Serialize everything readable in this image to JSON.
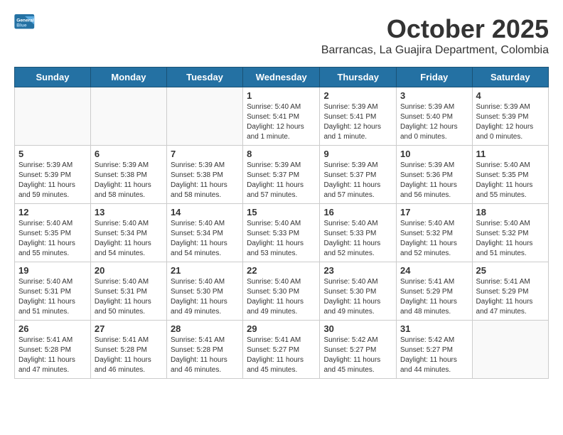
{
  "logo": {
    "line1": "General",
    "line2": "Blue"
  },
  "header": {
    "month_year": "October 2025",
    "location": "Barrancas, La Guajira Department, Colombia"
  },
  "days_of_week": [
    "Sunday",
    "Monday",
    "Tuesday",
    "Wednesday",
    "Thursday",
    "Friday",
    "Saturday"
  ],
  "weeks": [
    [
      {
        "day": "",
        "info": ""
      },
      {
        "day": "",
        "info": ""
      },
      {
        "day": "",
        "info": ""
      },
      {
        "day": "1",
        "info": "Sunrise: 5:40 AM\nSunset: 5:41 PM\nDaylight: 12 hours\nand 1 minute."
      },
      {
        "day": "2",
        "info": "Sunrise: 5:39 AM\nSunset: 5:41 PM\nDaylight: 12 hours\nand 1 minute."
      },
      {
        "day": "3",
        "info": "Sunrise: 5:39 AM\nSunset: 5:40 PM\nDaylight: 12 hours\nand 0 minutes."
      },
      {
        "day": "4",
        "info": "Sunrise: 5:39 AM\nSunset: 5:39 PM\nDaylight: 12 hours\nand 0 minutes."
      }
    ],
    [
      {
        "day": "5",
        "info": "Sunrise: 5:39 AM\nSunset: 5:39 PM\nDaylight: 11 hours\nand 59 minutes."
      },
      {
        "day": "6",
        "info": "Sunrise: 5:39 AM\nSunset: 5:38 PM\nDaylight: 11 hours\nand 58 minutes."
      },
      {
        "day": "7",
        "info": "Sunrise: 5:39 AM\nSunset: 5:38 PM\nDaylight: 11 hours\nand 58 minutes."
      },
      {
        "day": "8",
        "info": "Sunrise: 5:39 AM\nSunset: 5:37 PM\nDaylight: 11 hours\nand 57 minutes."
      },
      {
        "day": "9",
        "info": "Sunrise: 5:39 AM\nSunset: 5:37 PM\nDaylight: 11 hours\nand 57 minutes."
      },
      {
        "day": "10",
        "info": "Sunrise: 5:39 AM\nSunset: 5:36 PM\nDaylight: 11 hours\nand 56 minutes."
      },
      {
        "day": "11",
        "info": "Sunrise: 5:40 AM\nSunset: 5:35 PM\nDaylight: 11 hours\nand 55 minutes."
      }
    ],
    [
      {
        "day": "12",
        "info": "Sunrise: 5:40 AM\nSunset: 5:35 PM\nDaylight: 11 hours\nand 55 minutes."
      },
      {
        "day": "13",
        "info": "Sunrise: 5:40 AM\nSunset: 5:34 PM\nDaylight: 11 hours\nand 54 minutes."
      },
      {
        "day": "14",
        "info": "Sunrise: 5:40 AM\nSunset: 5:34 PM\nDaylight: 11 hours\nand 54 minutes."
      },
      {
        "day": "15",
        "info": "Sunrise: 5:40 AM\nSunset: 5:33 PM\nDaylight: 11 hours\nand 53 minutes."
      },
      {
        "day": "16",
        "info": "Sunrise: 5:40 AM\nSunset: 5:33 PM\nDaylight: 11 hours\nand 52 minutes."
      },
      {
        "day": "17",
        "info": "Sunrise: 5:40 AM\nSunset: 5:32 PM\nDaylight: 11 hours\nand 52 minutes."
      },
      {
        "day": "18",
        "info": "Sunrise: 5:40 AM\nSunset: 5:32 PM\nDaylight: 11 hours\nand 51 minutes."
      }
    ],
    [
      {
        "day": "19",
        "info": "Sunrise: 5:40 AM\nSunset: 5:31 PM\nDaylight: 11 hours\nand 51 minutes."
      },
      {
        "day": "20",
        "info": "Sunrise: 5:40 AM\nSunset: 5:31 PM\nDaylight: 11 hours\nand 50 minutes."
      },
      {
        "day": "21",
        "info": "Sunrise: 5:40 AM\nSunset: 5:30 PM\nDaylight: 11 hours\nand 49 minutes."
      },
      {
        "day": "22",
        "info": "Sunrise: 5:40 AM\nSunset: 5:30 PM\nDaylight: 11 hours\nand 49 minutes."
      },
      {
        "day": "23",
        "info": "Sunrise: 5:40 AM\nSunset: 5:30 PM\nDaylight: 11 hours\nand 49 minutes."
      },
      {
        "day": "24",
        "info": "Sunrise: 5:41 AM\nSunset: 5:29 PM\nDaylight: 11 hours\nand 48 minutes."
      },
      {
        "day": "25",
        "info": "Sunrise: 5:41 AM\nSunset: 5:29 PM\nDaylight: 11 hours\nand 47 minutes."
      }
    ],
    [
      {
        "day": "26",
        "info": "Sunrise: 5:41 AM\nSunset: 5:28 PM\nDaylight: 11 hours\nand 47 minutes."
      },
      {
        "day": "27",
        "info": "Sunrise: 5:41 AM\nSunset: 5:28 PM\nDaylight: 11 hours\nand 46 minutes."
      },
      {
        "day": "28",
        "info": "Sunrise: 5:41 AM\nSunset: 5:28 PM\nDaylight: 11 hours\nand 46 minutes."
      },
      {
        "day": "29",
        "info": "Sunrise: 5:41 AM\nSunset: 5:27 PM\nDaylight: 11 hours\nand 45 minutes."
      },
      {
        "day": "30",
        "info": "Sunrise: 5:42 AM\nSunset: 5:27 PM\nDaylight: 11 hours\nand 45 minutes."
      },
      {
        "day": "31",
        "info": "Sunrise: 5:42 AM\nSunset: 5:27 PM\nDaylight: 11 hours\nand 44 minutes."
      },
      {
        "day": "",
        "info": ""
      }
    ]
  ]
}
